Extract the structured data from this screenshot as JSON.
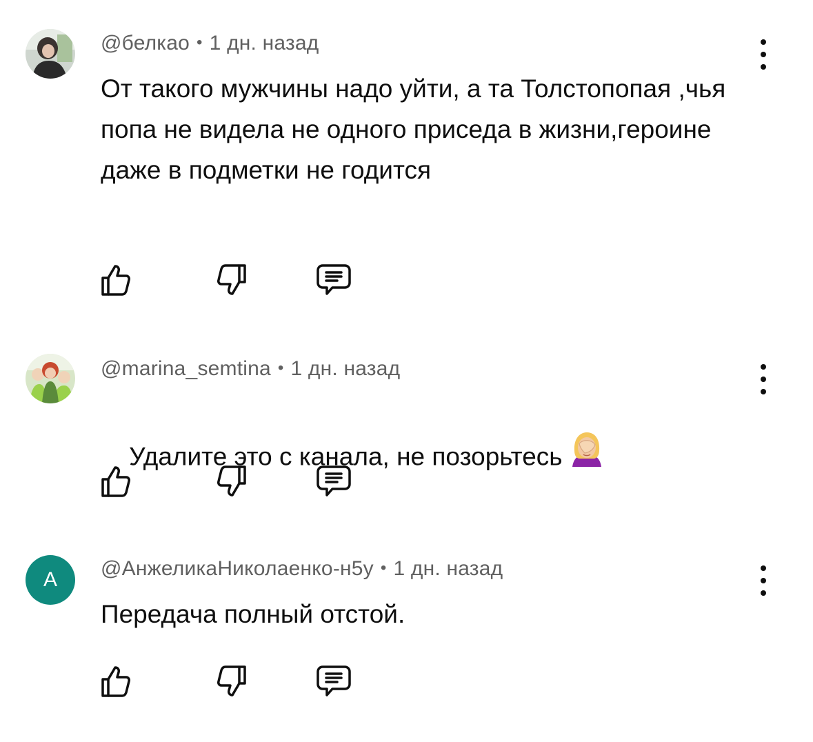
{
  "comments": [
    {
      "author": "@белкао",
      "separator": "•",
      "time": "1 дн. назад",
      "text": "От такого мужчины надо уйти, а та Толстопопая ,чья попа не видела не одного приседа в жизни,героине даже в подметки не годится",
      "avatar_icon": "photo-avatar"
    },
    {
      "author": "@marina_semtina",
      "separator": "•",
      "time": "1 дн. назад",
      "text": "Удалите это с канала, не позорьтесь",
      "emoji_icon": "face-palm-emoji",
      "avatar_icon": "photo-avatar"
    },
    {
      "author": "@АнжеликаНиколаенко-н5у",
      "separator": "•",
      "time": "1 дн. назад",
      "text": "Передача полный отстой.",
      "avatar_letter": "А",
      "avatar_color": "#0f8a7e"
    }
  ],
  "icons": {
    "like": "thumbs-up-icon",
    "dislike": "thumbs-down-icon",
    "reply": "comment-reply-icon",
    "more": "more-vertical-icon"
  }
}
